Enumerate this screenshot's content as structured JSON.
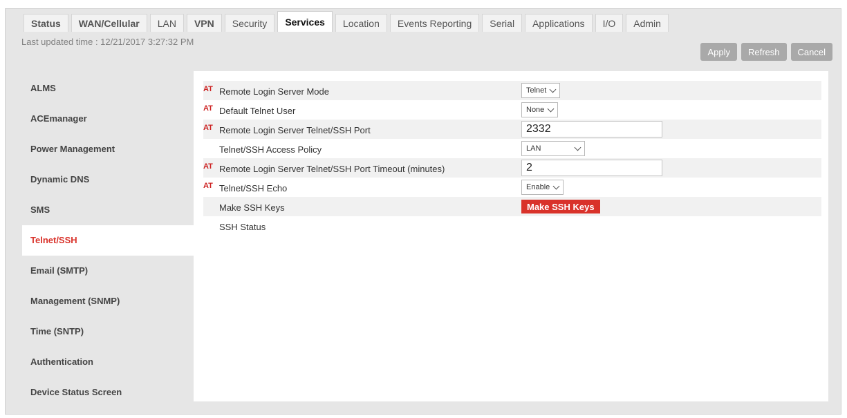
{
  "tabs": [
    {
      "label": "Status",
      "lite": false
    },
    {
      "label": "WAN/Cellular",
      "lite": false
    },
    {
      "label": "LAN",
      "lite": true
    },
    {
      "label": "VPN",
      "lite": false
    },
    {
      "label": "Security",
      "lite": true
    },
    {
      "label": "Services",
      "lite": false,
      "active": true
    },
    {
      "label": "Location",
      "lite": true
    },
    {
      "label": "Events Reporting",
      "lite": true
    },
    {
      "label": "Serial",
      "lite": true
    },
    {
      "label": "Applications",
      "lite": true
    },
    {
      "label": "I/O",
      "lite": true
    },
    {
      "label": "Admin",
      "lite": true
    }
  ],
  "toolbar": {
    "last_updated": "Last updated time : 12/21/2017 3:27:32 PM",
    "apply_label": "Apply",
    "refresh_label": "Refresh",
    "cancel_label": "Cancel"
  },
  "sidebar": {
    "items": [
      {
        "label": "ALMS"
      },
      {
        "label": "ACEmanager"
      },
      {
        "label": "Power Management"
      },
      {
        "label": "Dynamic DNS"
      },
      {
        "label": "SMS"
      },
      {
        "label": "Telnet/SSH",
        "active": true
      },
      {
        "label": "Email (SMTP)"
      },
      {
        "label": "Management (SNMP)"
      },
      {
        "label": "Time (SNTP)"
      },
      {
        "label": "Authentication"
      },
      {
        "label": "Device Status Screen"
      }
    ]
  },
  "form": {
    "at_marker": "AT",
    "rows": [
      {
        "label": "Remote Login Server Mode",
        "at": true,
        "type": "select",
        "value": "Telnet"
      },
      {
        "label": "Default Telnet User",
        "at": true,
        "type": "select",
        "value": "None"
      },
      {
        "label": "Remote Login Server Telnet/SSH Port",
        "at": true,
        "type": "input",
        "value": "2332"
      },
      {
        "label": "Telnet/SSH Access Policy",
        "at": false,
        "type": "select",
        "value": "LAN"
      },
      {
        "label": "Remote Login Server Telnet/SSH Port Timeout (minutes)",
        "at": true,
        "type": "input",
        "value": "2"
      },
      {
        "label": "Telnet/SSH Echo",
        "at": true,
        "type": "select",
        "value": "Enable"
      },
      {
        "label": "Make SSH Keys",
        "at": false,
        "type": "button",
        "value": "Make SSH Keys"
      },
      {
        "label": "SSH Status",
        "at": false,
        "type": "none",
        "value": ""
      }
    ]
  },
  "colors": {
    "accent": "#d9322a",
    "at_marker": "#cc1f1f",
    "button_grey": "#a9a9a9",
    "background": "#e6e6e6"
  }
}
